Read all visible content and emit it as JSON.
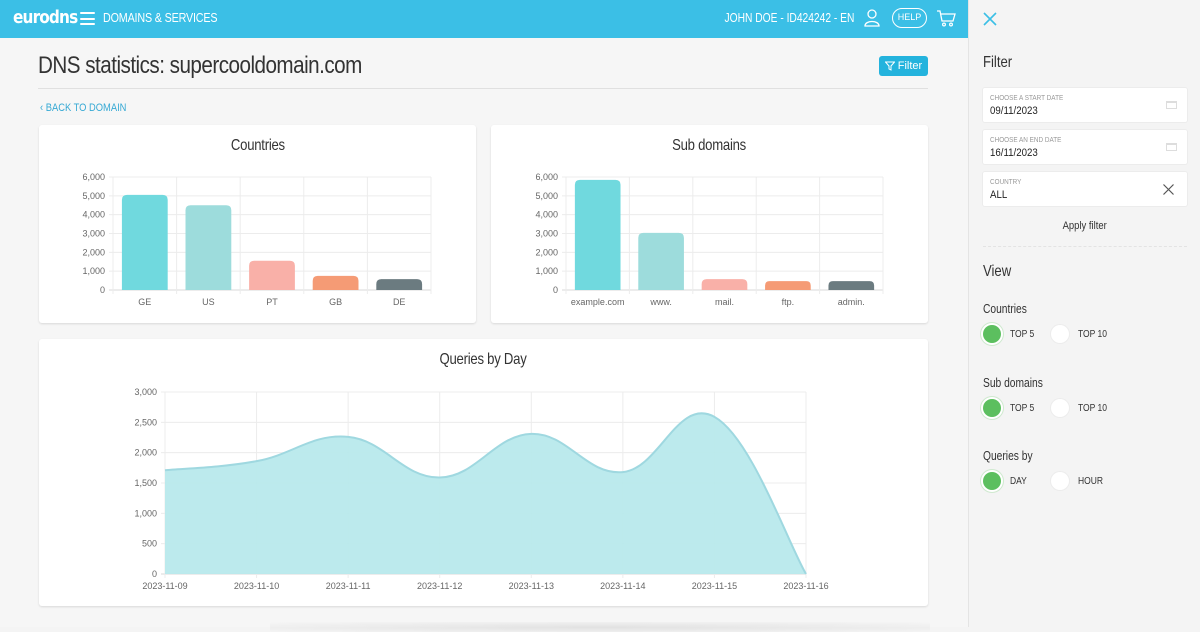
{
  "header": {
    "logo": "eurodns",
    "nav_label": "DOMAINS & SERVICES",
    "user_label": "JOHN DOE - ID424242 - EN",
    "help_label": "HELP",
    "icons": {
      "menu": "hamburger-icon",
      "user": "user-icon",
      "cart": "cart-icon"
    },
    "color": "#3bbfe6"
  },
  "main": {
    "title": "DNS statistics: supercooldomain.com",
    "filter_button": "Filter",
    "back_link": "BACK TO DOMAIN"
  },
  "colors": {
    "accent": "#24b3dd",
    "bars": [
      "#70d9de",
      "#9ddcdc",
      "#f9b0a8",
      "#f59b75",
      "#6b7b80"
    ],
    "area_fill": "#b8e9ec",
    "area_line": "#9fd8e0",
    "radio_on": "#5cbf5f"
  },
  "chart_data": [
    {
      "type": "bar",
      "title": "Countries",
      "categories": [
        "GE",
        "US",
        "PT",
        "GB",
        "DE"
      ],
      "values": [
        5050,
        4500,
        1550,
        750,
        580
      ],
      "ylim": [
        0,
        6000
      ],
      "yticks": [
        "6,000",
        "5,000",
        "4,000",
        "3,000",
        "2,000",
        "1,000",
        "0"
      ],
      "grid": true,
      "legend": "none"
    },
    {
      "type": "bar",
      "title": "Sub domains",
      "categories": [
        "example.com",
        "www.",
        "mail.",
        "ftp.",
        "admin."
      ],
      "values": [
        5850,
        3030,
        580,
        470,
        470
      ],
      "ylim": [
        0,
        6000
      ],
      "yticks": [
        "6,000",
        "5,000",
        "4,000",
        "3,000",
        "2,000",
        "1,000",
        "0"
      ],
      "grid": true,
      "legend": "none"
    },
    {
      "type": "area",
      "title": "Queries by Day",
      "x": [
        "2023-11-09",
        "2023-11-10",
        "2023-11-11",
        "2023-11-12",
        "2023-11-13",
        "2023-11-14",
        "2023-11-15",
        "2023-11-16"
      ],
      "values": [
        1710,
        1860,
        2260,
        1590,
        2310,
        1680,
        2590,
        0
      ],
      "ylim": [
        0,
        3000
      ],
      "yticks": [
        "3,000",
        "2,500",
        "2,000",
        "1,500",
        "1,000",
        "500",
        "0"
      ],
      "grid": true,
      "legend": "none"
    }
  ],
  "panel": {
    "filter_heading": "Filter",
    "start_date": {
      "label": "CHOOSE A START DATE",
      "value": "09/11/2023"
    },
    "end_date": {
      "label": "CHOOSE AN END DATE",
      "value": "16/11/2023"
    },
    "country": {
      "label": "COUNTRY",
      "value": "ALL"
    },
    "apply_label": "Apply filter",
    "view_heading": "View",
    "groups": [
      {
        "label": "Countries",
        "options": [
          "TOP 5",
          "TOP 10"
        ],
        "selected": "TOP 5"
      },
      {
        "label": "Sub domains",
        "options": [
          "TOP 5",
          "TOP 10"
        ],
        "selected": "TOP 5"
      },
      {
        "label": "Queries by",
        "options": [
          "DAY",
          "HOUR"
        ],
        "selected": "DAY"
      }
    ]
  }
}
